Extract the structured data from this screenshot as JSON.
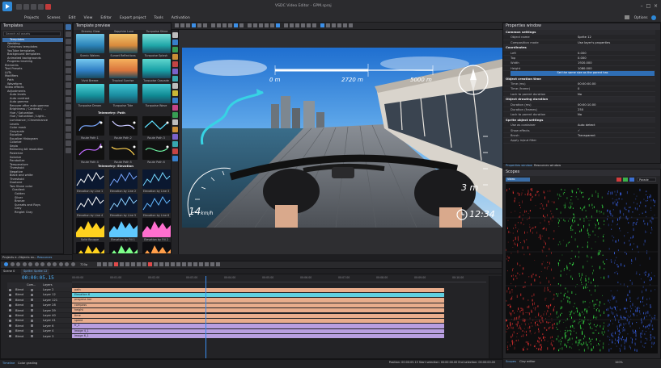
{
  "window": {
    "title": "VSDC Video Editor - GPM.sproj",
    "menu": [
      "Projects",
      "Scenes",
      "Edit",
      "View",
      "Editor",
      "Export project",
      "Tools",
      "Activation"
    ],
    "options_label": "Options"
  },
  "templates": {
    "title": "Templates",
    "search_placeholder": "Search all assets",
    "tree": [
      "Templates",
      "Wedding",
      "Christmas templates",
      "YouTube templates",
      "Background templates",
      "Animated backgrounds",
      "Progress tracking",
      "Elements",
      "Text Presets",
      "LUTs",
      "Modifiers",
      "Path",
      "Waveform",
      "Video effects",
      "Adjustments",
      "Auto levels",
      "Auto contrast",
      "Auto gamma",
      "Recover after auto gamma",
      "Brightness / Contrast / ...",
      "Hue / Saturation",
      "Hue / Saturation / Light...",
      "Luminance / Chrominance",
      "Levels",
      "Color mask",
      "Grayscale",
      "Equalize",
      "Equalize Histogram",
      "Colorize",
      "Sepia",
      "Reducing bit resolution",
      "Posterize",
      "Solarize",
      "Parabolize",
      "Temperature",
      "Threshold",
      "Negative",
      "Black and white",
      "Threshold",
      "Duotone",
      "Two Stone color",
      "Gradient",
      "Golden",
      "Silver",
      "Bronze",
      "Sunsets and Rays",
      "Grey",
      "Ringlet Gray"
    ]
  },
  "preview": {
    "title": "Template preview",
    "top_labels": [
      "Dreamy Glow",
      "Sapphire Luxe",
      "Turquoise Shine"
    ],
    "row1": [
      "Scenic Waters",
      "Sunset Reflections",
      "Turquoise Splash"
    ],
    "row2": [
      "Vivid Breeze",
      "Tropical Sunrise",
      "Turquoise Cascade"
    ],
    "row3": [
      "Turquoise Dream",
      "Turquoise Tide",
      "Turquoise Wave"
    ],
    "section_path": "Telemetry: Path",
    "path_labels": [
      "Route Path 1",
      "Route Path 2",
      "Route Path 3",
      "Route Path 4",
      "Route Path 5",
      "Route Path 6"
    ],
    "section_elevation": "Telemetry: Elevation",
    "elev_labels": [
      "Elevation by Line 1",
      "Elevation by Line 2",
      "Elevation by Line 3",
      "Elevation by Line 4",
      "Elevation by Line 5",
      "Elevation by Line 6"
    ],
    "fill_labels": [
      "Solid Bouque",
      "Elevation by Fill 1",
      "Elevation by Fill 2",
      "Elevation by Fill 3",
      "Elevation by Fill 4",
      "Elevation by Fill 5",
      "Elevation by Fill 6"
    ]
  },
  "video": {
    "distance_start": "0 m",
    "distance_mid": "2720 m",
    "distance_end": "5000 m",
    "speed": "14",
    "speed_unit": "km/h",
    "elevation": "3 m",
    "clock": "12:34",
    "gauge_ticks": [
      "0",
      "5",
      "10",
      "15",
      "20",
      "25",
      "30"
    ],
    "elev_ticks": [
      "12",
      "9",
      "6",
      "3"
    ]
  },
  "properties": {
    "title": "Properties window",
    "common": "Common settings",
    "rows_common": [
      [
        "Object name",
        "Sprite 12"
      ],
      [
        "Composition mode",
        "Use layer's properties"
      ]
    ],
    "coords": "Coordinates",
    "rows_coords": [
      [
        "Left",
        "0.000"
      ],
      [
        "Top",
        "0.000"
      ],
      [
        "Width",
        "1920.000"
      ],
      [
        "Height",
        "1080.000"
      ]
    ],
    "set_same": "Set the same size as the parent has",
    "creation": "Object creation time",
    "rows_creation": [
      [
        "Time (ms)",
        "00:00:00.00"
      ],
      [
        "Time (frame)",
        "0"
      ],
      [
        "Lock to parent duration",
        "No"
      ]
    ],
    "drawing": "Object drawing duration",
    "rows_drawing": [
      [
        "Duration (ms)",
        "00:00:10.00"
      ],
      [
        "Duration (frames)",
        "250"
      ],
      [
        "Lock to parent duration",
        "No"
      ]
    ],
    "sprite": "Sprite object settings",
    "rows_sprite": [
      [
        "Use as container",
        "Auto detect"
      ],
      [
        "Show effects",
        "✓"
      ],
      [
        "Brush",
        "Transparent"
      ],
      [
        "Apply in/out filter",
        ""
      ]
    ],
    "tabs": [
      "Properties window",
      "Resources window"
    ]
  },
  "scopes": {
    "title": "Scopes",
    "mode": "Parade",
    "source": "Video"
  },
  "timeline": {
    "tabs": [
      "Projects e...",
      "Objects ex...",
      "Resources"
    ],
    "scene_tabs": [
      "Scene 0",
      "Sprite: Sprite 12"
    ],
    "time": "00:00:05.15",
    "zoom": "720p",
    "headers": [
      "Com...",
      "Layers"
    ],
    "tracks": [
      {
        "blend": "Blend",
        "layer": "Layer 2",
        "clip": "path",
        "color": "#e9ad8c"
      },
      {
        "blend": "Blend",
        "layer": "Layer 12",
        "clip": "Elevation 6",
        "color": "#5fcfe0"
      },
      {
        "blend": "Blend",
        "layer": "Layer 121",
        "clip": "progress bar",
        "color": "#e9ad8c"
      },
      {
        "blend": "Blend",
        "layer": "Layer 28",
        "clip": "compass",
        "color": "#e9ad8c"
      },
      {
        "blend": "Blend",
        "layer": "Layer 39",
        "clip": "height",
        "color": "#e9ad8c"
      },
      {
        "blend": "Blend",
        "layer": "Layer 40",
        "clip": "time",
        "color": "#e9ad8c"
      },
      {
        "blend": "Blend",
        "layer": "Layer 41",
        "clip": "speed",
        "color": "#e9ad8c"
      },
      {
        "blend": "Blend",
        "layer": "Layer 6",
        "clip": "fr_1",
        "color": "#b89ee0"
      },
      {
        "blend": "Blend",
        "layer": "Layer 4",
        "clip": "Image 4_1",
        "color": "#b89ee0"
      },
      {
        "blend": "Blend",
        "layer": "Layer 3",
        "clip": "Image 6_1",
        "color": "#b89ee0"
      }
    ],
    "ruler": [
      "00:00:00",
      "00:01.00",
      "00:02.00",
      "00:03.00",
      "00:04.00",
      "00:05.00",
      "00:06.00",
      "00:07.00",
      "00:08.00",
      "00:09.00",
      "00:10.00"
    ],
    "bottom_tabs": [
      "Timeline",
      "Color grading"
    ],
    "status": "Position: 00:00:05.15   Start selection: 00:00:00.00   End selection: 00:00:00.00",
    "zoom_pct": "100%",
    "scopes_tabs": [
      "Scopes",
      "Clay editor"
    ]
  }
}
